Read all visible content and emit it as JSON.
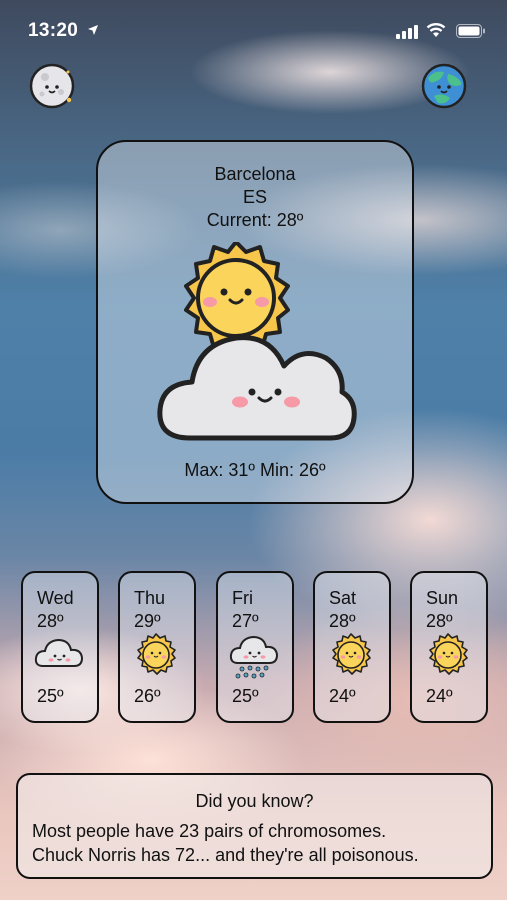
{
  "status_bar": {
    "time": "13:20",
    "icons": [
      "location-arrow-icon",
      "signal-icon",
      "wifi-icon",
      "battery-icon"
    ]
  },
  "header": {
    "left_icon": "moon-icon",
    "right_icon": "earth-icon"
  },
  "current_weather": {
    "city": "Barcelona",
    "country": "ES",
    "current": "Current: 28º",
    "icon": "sun-behind-cloud-icon",
    "minmax": "Max: 31º Min: 26º"
  },
  "forecast": [
    {
      "day": "Wed",
      "max": "28º",
      "min": "25º",
      "icon": "cloud-icon"
    },
    {
      "day": "Thu",
      "max": "29º",
      "min": "26º",
      "icon": "sun-icon"
    },
    {
      "day": "Fri",
      "max": "27º",
      "min": "25º",
      "icon": "rain-cloud-icon"
    },
    {
      "day": "Sat",
      "max": "28º",
      "min": "24º",
      "icon": "sun-icon"
    },
    {
      "day": "Sun",
      "max": "28º",
      "min": "24º",
      "icon": "sun-icon"
    }
  ],
  "fact": {
    "title": "Did you know?",
    "line1": "Most people have 23 pairs of chromosomes.",
    "line2": "Chuck Norris has 72... and they're all poisonous."
  },
  "colors": {
    "sun": "#f7c64a",
    "sun_outline": "#222222",
    "cloud": "#e7e7ea",
    "blush": "#f59aa6",
    "rain": "#5aa6c8",
    "earth_land": "#4cc08a",
    "earth_sea": "#3f8fd4"
  }
}
